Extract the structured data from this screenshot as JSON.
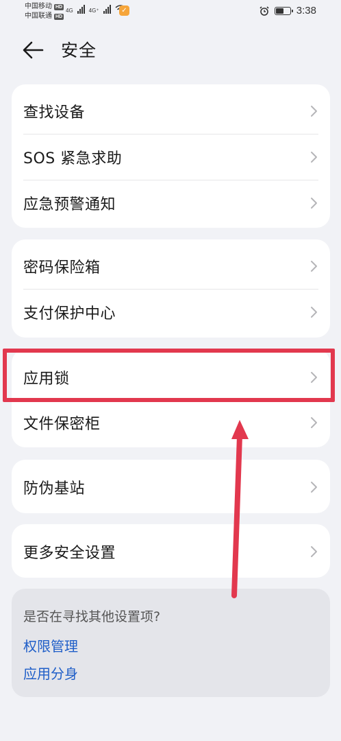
{
  "status_bar": {
    "carrier_1": "中国移动",
    "carrier_2": "中国联通",
    "hd": "HD",
    "net_1": "4G",
    "net_2": "4G⁺",
    "time": "3:38",
    "battery_level": 0.5
  },
  "header": {
    "title": "安全"
  },
  "group_1": {
    "items": [
      {
        "label": "查找设备"
      },
      {
        "label": "SOS 紧急求助"
      },
      {
        "label": "应急预警通知"
      }
    ]
  },
  "group_2": {
    "items": [
      {
        "label": "密码保险箱"
      },
      {
        "label": "支付保护中心"
      }
    ]
  },
  "group_3": {
    "items": [
      {
        "label": "应用锁"
      },
      {
        "label": "文件保密柜"
      }
    ]
  },
  "group_4": {
    "items": [
      {
        "label": "防伪基站"
      }
    ]
  },
  "group_5": {
    "items": [
      {
        "label": "更多安全设置"
      }
    ]
  },
  "suggestions": {
    "title": "是否在寻找其他设置项?",
    "links": [
      {
        "label": "权限管理"
      },
      {
        "label": "应用分身"
      }
    ]
  },
  "colors": {
    "link": "#1f5ec8",
    "annotation": "#e2384e",
    "background": "#f1f2f6"
  },
  "icons": {
    "back": "arrow-left-icon",
    "chevron": "chevron-right-icon",
    "alarm": "alarm-clock-icon",
    "battery": "battery-icon",
    "wifi": "wifi-icon"
  }
}
